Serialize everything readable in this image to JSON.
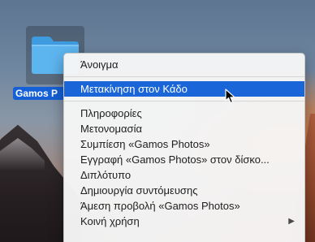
{
  "desktop": {
    "folder": {
      "icon": "folder-icon",
      "label": "Gamos P",
      "color": "#5db5f0"
    }
  },
  "context_menu": {
    "groups": [
      [
        {
          "label": "Άνοιγμα"
        }
      ],
      [
        {
          "label": "Μετακίνηση στον Κάδο",
          "highlighted": true
        }
      ],
      [
        {
          "label": "Πληροφορίες"
        },
        {
          "label": "Μετονομασία"
        },
        {
          "label": "Συμπίεση «Gamos Photos»"
        },
        {
          "label": "Εγγραφή «Gamos Photos» στον δίσκο..."
        },
        {
          "label": "Διπλότυπο"
        },
        {
          "label": "Δημιουργία συντόμευσης"
        },
        {
          "label": "Άμεση προβολή «Gamos Photos»"
        },
        {
          "label": "Κοινή χρήση",
          "submenu_icon": "chevron-right-icon"
        }
      ]
    ],
    "highlight_color": "#1a66d8"
  },
  "cursor": {
    "icon": "pointer-cursor-icon"
  }
}
